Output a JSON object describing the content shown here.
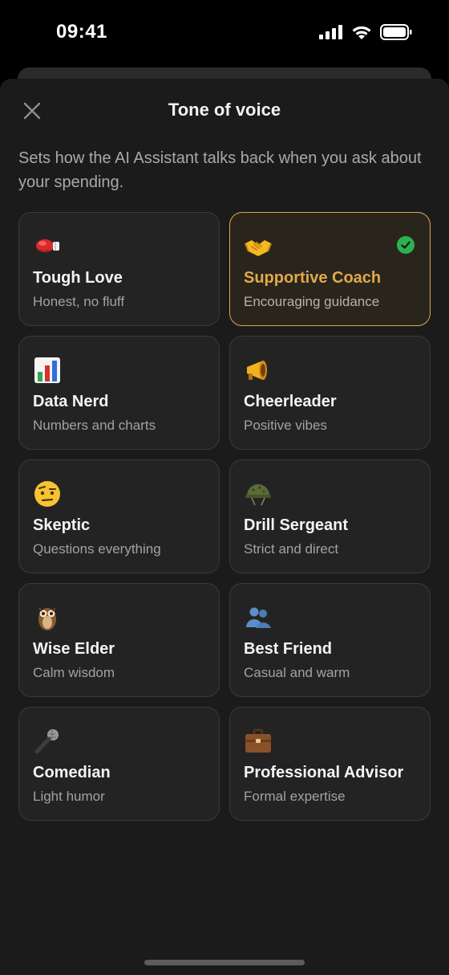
{
  "status_bar": {
    "time": "09:41"
  },
  "sheet": {
    "title": "Tone of voice",
    "description": "Sets how the AI Assistant talks back when you ask about your spending.",
    "close_icon": "close-icon"
  },
  "accent_color": "#d9a84a",
  "check_color": "#2bb24f",
  "tones": [
    {
      "icon": "boxing-glove-icon",
      "title": "Tough Love",
      "subtitle": "Honest, no fluff",
      "selected": false
    },
    {
      "icon": "handshake-icon",
      "title": "Supportive Coach",
      "subtitle": "Encouraging guidance",
      "selected": true
    },
    {
      "icon": "bar-chart-icon",
      "title": "Data Nerd",
      "subtitle": "Numbers and charts",
      "selected": false
    },
    {
      "icon": "megaphone-icon",
      "title": "Cheerleader",
      "subtitle": "Positive vibes",
      "selected": false
    },
    {
      "icon": "raised-eyebrow-face-icon",
      "title": "Skeptic",
      "subtitle": "Questions everything",
      "selected": false
    },
    {
      "icon": "military-helmet-icon",
      "title": "Drill Sergeant",
      "subtitle": "Strict and direct",
      "selected": false
    },
    {
      "icon": "owl-icon",
      "title": "Wise Elder",
      "subtitle": "Calm wisdom",
      "selected": false
    },
    {
      "icon": "two-people-icon",
      "title": "Best Friend",
      "subtitle": "Casual and warm",
      "selected": false
    },
    {
      "icon": "microphone-icon",
      "title": "Comedian",
      "subtitle": "Light humor",
      "selected": false
    },
    {
      "icon": "briefcase-icon",
      "title": "Professional Advisor",
      "subtitle": "Formal expertise",
      "selected": false
    }
  ]
}
